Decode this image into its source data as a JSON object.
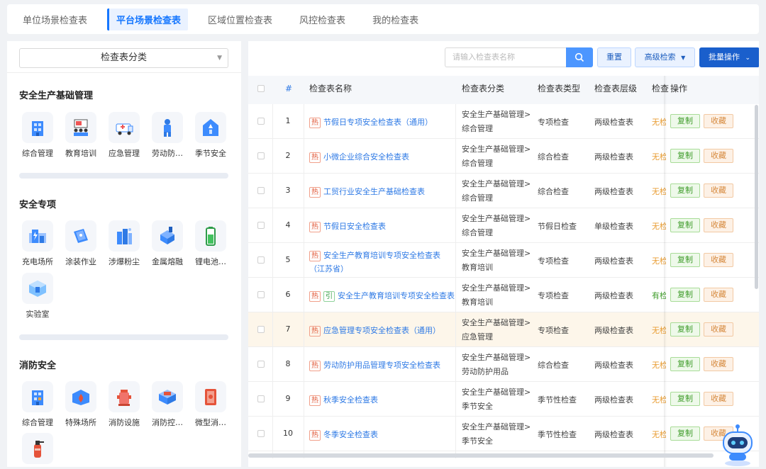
{
  "tabs": [
    {
      "label": "单位场景检查表",
      "active": false
    },
    {
      "label": "平台场景检查表",
      "active": true
    },
    {
      "label": "区域位置检查表",
      "active": false
    },
    {
      "label": "风控检查表",
      "active": false
    },
    {
      "label": "我的检查表",
      "active": false
    }
  ],
  "sidebar": {
    "select_label": "检查表分类",
    "sections": [
      {
        "title": "安全生产基础管理",
        "items": [
          "综合管理",
          "教育培训",
          "应急管理",
          "劳动防…",
          "季节安全"
        ]
      },
      {
        "title": "安全专项",
        "items": [
          "充电场所",
          "涂装作业",
          "涉爆粉尘",
          "金属熔融",
          "锂电池…",
          "实验室"
        ]
      },
      {
        "title": "消防安全",
        "items": [
          "综合管理",
          "特殊场所",
          "消防设施",
          "消防控…",
          "微型消…"
        ]
      }
    ]
  },
  "toolbar": {
    "search_placeholder": "请输入检查表名称",
    "reset_label": "重置",
    "advanced_label": "高级检索",
    "batch_label": "批量操作"
  },
  "table": {
    "headers": {
      "index": "#",
      "name": "检查表名称",
      "category": "检查表分类",
      "type": "检查表类型",
      "level": "检查表层级",
      "status": "检查",
      "action": "操作"
    },
    "hot_tag": "热",
    "extra_tag": "引",
    "copy_label": "复制",
    "fav_label": "收藏",
    "rows": [
      {
        "no": "1",
        "name": "节假日专项安全检查表（通用）",
        "name2": "",
        "cat1": "安全生产基础管理>",
        "cat2": "综合管理",
        "type": "专项检查",
        "level": "两级检查表",
        "status": "无检"
      },
      {
        "no": "2",
        "name": "小微企业综合安全检查表",
        "name2": "",
        "cat1": "安全生产基础管理>",
        "cat2": "综合管理",
        "type": "综合检查",
        "level": "两级检查表",
        "status": "无检"
      },
      {
        "no": "3",
        "name": "工贸行业安全生产基础检查表",
        "name2": "",
        "cat1": "安全生产基础管理>",
        "cat2": "综合管理",
        "type": "综合检查",
        "level": "两级检查表",
        "status": "无检"
      },
      {
        "no": "4",
        "name": "节假日安全检查表",
        "name2": "",
        "cat1": "安全生产基础管理>",
        "cat2": "综合管理",
        "type": "节假日检查",
        "level": "单级检查表",
        "status": "无检"
      },
      {
        "no": "5",
        "name": "安全生产教育培训专项安全检查表",
        "name2": "（江苏省）",
        "cat1": "安全生产基础管理>",
        "cat2": "教育培训",
        "type": "专项检查",
        "level": "两级检查表",
        "status": "无检"
      },
      {
        "no": "6",
        "name": "安全生产教育培训专项安全检查表",
        "name2": "",
        "cat1": "安全生产基础管理>",
        "cat2": "教育培训",
        "type": "专项检查",
        "level": "两级检查表",
        "status": "有检"
      },
      {
        "no": "7",
        "name": "应急管理专项安全检查表（通用）",
        "name2": "",
        "cat1": "安全生产基础管理>",
        "cat2": "应急管理",
        "type": "专项检查",
        "level": "两级检查表",
        "status": "无检"
      },
      {
        "no": "8",
        "name": "劳动防护用品管理专项安全检查表",
        "name2": "",
        "cat1": "安全生产基础管理>",
        "cat2": "劳动防护用品",
        "type": "综合检查",
        "level": "两级检查表",
        "status": "无检"
      },
      {
        "no": "9",
        "name": "秋季安全检查表",
        "name2": "",
        "cat1": "安全生产基础管理>",
        "cat2": "季节安全",
        "type": "季节性检查",
        "level": "两级检查表",
        "status": "无检"
      },
      {
        "no": "10",
        "name": "冬季安全检查表",
        "name2": "",
        "cat1": "安全生产基础管理>",
        "cat2": "季节安全",
        "type": "季节性检查",
        "level": "两级检查表",
        "status": "无检"
      }
    ]
  },
  "colors": {
    "accent": "#1677ff",
    "hot": "#e15a3a",
    "copy": "#3f9c2a",
    "fav": "#d68a3e",
    "row_highlight": "#fdf6ea"
  }
}
